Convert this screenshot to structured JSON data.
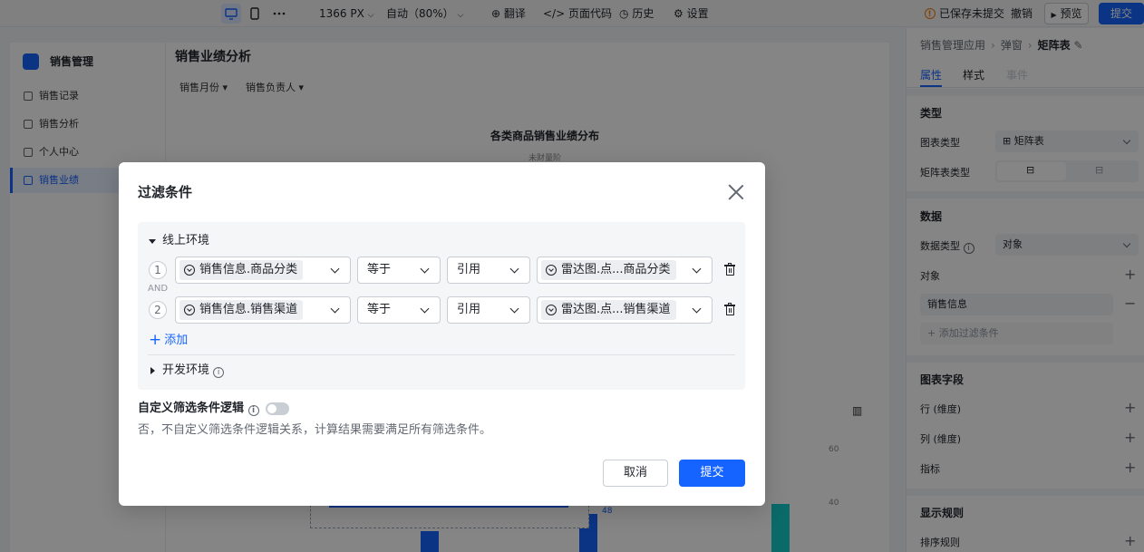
{
  "toolbar": {
    "resolution": "1366 PX",
    "zoom": "自动（80%）",
    "translate": "翻译",
    "page_code": "页面代码",
    "history": "历史",
    "settings": "设置",
    "save_status": "已保存未提交",
    "undo": "撤销",
    "preview": "预览",
    "submit": "提交"
  },
  "preview": {
    "app_name": "销售管理",
    "nav": [
      {
        "label": "销售记录",
        "active": false
      },
      {
        "label": "销售分析",
        "active": false
      },
      {
        "label": "个人中心",
        "active": false
      },
      {
        "label": "销售业绩",
        "active": true
      }
    ],
    "page_title": "销售业绩分析",
    "filters": [
      "销售月份",
      "销售负责人"
    ],
    "chart_title": "各类商品销售业绩分布",
    "chart_subtitle": "未财量阶",
    "axis_ticks": [
      "60",
      "40"
    ],
    "bar_labels": [
      "48"
    ]
  },
  "panel": {
    "breadcrumb": [
      "销售管理应用",
      "弹窗",
      "矩阵表"
    ],
    "tabs": [
      {
        "label": "属性",
        "state": "active"
      },
      {
        "label": "样式",
        "state": "normal"
      },
      {
        "label": "事件",
        "state": "disabled"
      }
    ],
    "type_section": "类型",
    "chart_type_label": "图表类型",
    "chart_type_value": "矩阵表",
    "matrix_type_label": "矩阵表类型",
    "data_section": "数据",
    "data_type_label": "数据类型",
    "data_type_value": "对象",
    "object_label": "对象",
    "object_value": "销售信息",
    "add_filter": "添加过滤条件",
    "fields_section": "图表字段",
    "row_dim": "行 (维度)",
    "col_dim": "列 (维度)",
    "metric": "指标",
    "display_section": "显示规则",
    "sort_rule": "排序规则"
  },
  "modal": {
    "title": "过滤条件",
    "online_env": "线上环境",
    "conditions": [
      {
        "index": "1",
        "field": "销售信息.商品分类",
        "operator": "等于",
        "value_type": "引用",
        "value": "雷达图.点...商品分类"
      },
      {
        "index": "2",
        "field": "销售信息.销售渠道",
        "operator": "等于",
        "value_type": "引用",
        "value": "雷达图.点...销售渠道"
      }
    ],
    "and_label": "AND",
    "add": "添加",
    "dev_env": "开发环境",
    "custom_logic_label": "自定义筛选条件逻辑",
    "custom_logic_desc": "否，不自定义筛选条件逻辑关系，计算结果需要满足所有筛选条件。",
    "cancel": "取消",
    "submit": "提交"
  },
  "colors": {
    "primary": "#1664ff",
    "overlay": "rgba(0,0,0,0.48)"
  }
}
